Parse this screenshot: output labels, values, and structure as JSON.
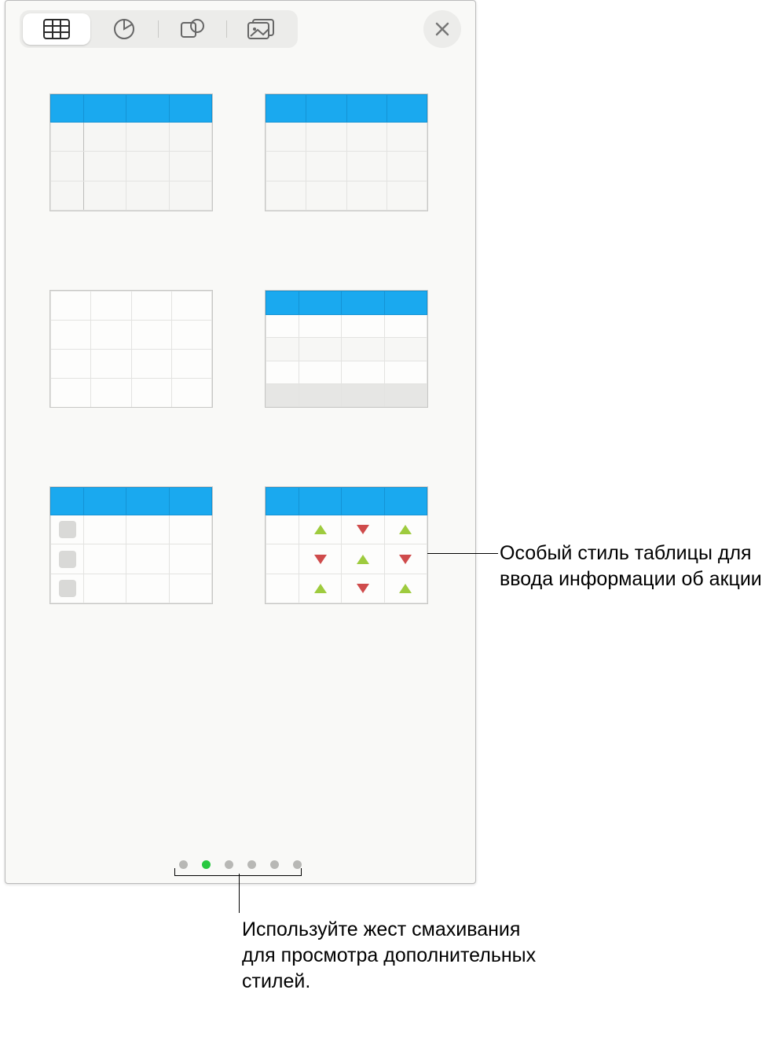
{
  "toolbar": {
    "tabs": [
      "table",
      "chart",
      "shape",
      "media"
    ],
    "active_tab_index": 0
  },
  "table_styles": [
    {
      "id": "blue-header-row-col",
      "name": "table-style-blue-header-1"
    },
    {
      "id": "blue-header-basic",
      "name": "table-style-blue-header-2"
    },
    {
      "id": "plain-grid",
      "name": "table-style-plain"
    },
    {
      "id": "blue-header-footer",
      "name": "table-style-header-footer"
    },
    {
      "id": "checklist",
      "name": "table-style-checklist"
    },
    {
      "id": "stock-tracker",
      "name": "table-style-stock"
    }
  ],
  "pagination": {
    "total_pages": 6,
    "current_page": 1
  },
  "callouts": {
    "stock_style": "Особый стиль таблицы для ввода информации об акции",
    "swipe_hint": "Используйте жест смахивания для просмотра дополнительных стилей."
  },
  "colors": {
    "header_blue": "#1aa9ef",
    "active_dot": "#28c840",
    "up_triangle": "#9ecb3e",
    "down_triangle": "#cf4b4b"
  }
}
